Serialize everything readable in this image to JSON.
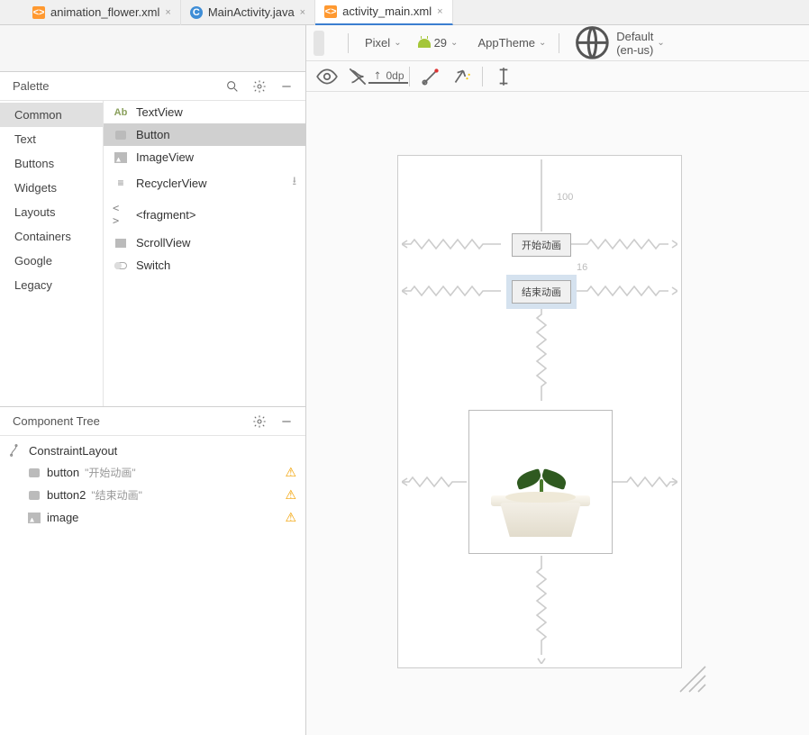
{
  "tabs": [
    {
      "label": "animation_flower.xml",
      "active": false,
      "type": "xml"
    },
    {
      "label": "MainActivity.java",
      "active": false,
      "type": "java"
    },
    {
      "label": "activity_main.xml",
      "active": true,
      "type": "xml"
    }
  ],
  "palette": {
    "title": "Palette",
    "categories": [
      "Common",
      "Text",
      "Buttons",
      "Widgets",
      "Layouts",
      "Containers",
      "Google",
      "Legacy"
    ],
    "selected_category": "Common",
    "widgets": [
      {
        "name": "TextView",
        "icon": "textview"
      },
      {
        "name": "Button",
        "icon": "button",
        "selected": true
      },
      {
        "name": "ImageView",
        "icon": "image"
      },
      {
        "name": "RecyclerView",
        "icon": "list",
        "download": true
      },
      {
        "name": "<fragment>",
        "icon": "frag"
      },
      {
        "name": "ScrollView",
        "icon": "scroll"
      },
      {
        "name": "Switch",
        "icon": "switch"
      }
    ]
  },
  "component_tree": {
    "title": "Component Tree",
    "root": "ConstraintLayout",
    "children": [
      {
        "id": "button",
        "text": "\"开始动画\"",
        "warning": true
      },
      {
        "id": "button2",
        "text": "\"结束动画\"",
        "warning": true
      },
      {
        "id": "image",
        "text": "",
        "warning": true,
        "icon": "image"
      }
    ]
  },
  "designer": {
    "device": "Pixel",
    "api": "29",
    "theme": "AppTheme",
    "locale": "Default (en-us)",
    "default_margin": "0dp",
    "measurements": {
      "top": "100",
      "gap": "16"
    },
    "buttons": {
      "start": "开始动画",
      "end": "结束动画"
    }
  }
}
